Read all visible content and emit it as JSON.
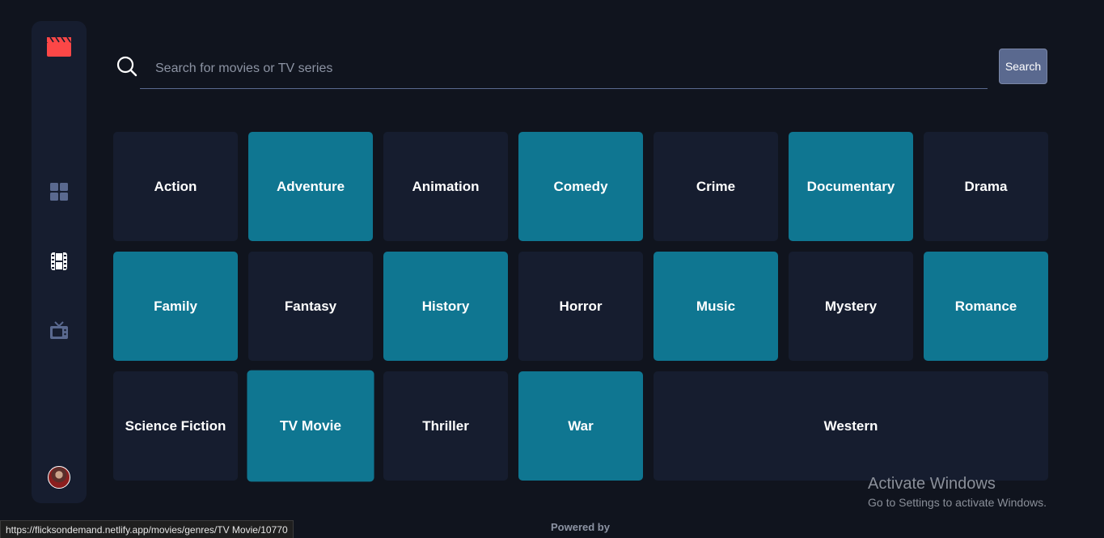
{
  "sidebar": {
    "logo_icon": "clapperboard-icon",
    "nav": [
      {
        "icon": "grid-icon",
        "label": "Home"
      },
      {
        "icon": "film-icon",
        "label": "Movies"
      },
      {
        "icon": "tv-icon",
        "label": "TV Series"
      }
    ]
  },
  "search": {
    "placeholder": "Search for movies or TV series",
    "value": "",
    "button_label": "Search"
  },
  "genres": [
    {
      "label": "Action",
      "style": "dark"
    },
    {
      "label": "Adventure",
      "style": "teal"
    },
    {
      "label": "Animation",
      "style": "dark"
    },
    {
      "label": "Comedy",
      "style": "teal"
    },
    {
      "label": "Crime",
      "style": "dark"
    },
    {
      "label": "Documentary",
      "style": "teal"
    },
    {
      "label": "Drama",
      "style": "dark"
    },
    {
      "label": "Family",
      "style": "teal"
    },
    {
      "label": "Fantasy",
      "style": "dark"
    },
    {
      "label": "History",
      "style": "teal"
    },
    {
      "label": "Horror",
      "style": "dark"
    },
    {
      "label": "Music",
      "style": "teal"
    },
    {
      "label": "Mystery",
      "style": "dark"
    },
    {
      "label": "Romance",
      "style": "teal"
    },
    {
      "label": "Science Fiction",
      "style": "dark"
    },
    {
      "label": "TV Movie",
      "style": "teal",
      "hovered": true
    },
    {
      "label": "Thriller",
      "style": "dark"
    },
    {
      "label": "War",
      "style": "teal"
    },
    {
      "label": "Western",
      "style": "dark"
    }
  ],
  "footer": {
    "powered_by": "Powered by"
  },
  "status_bar": {
    "url": "https://flicksondemand.netlify.app/movies/genres/TV Movie/10770"
  },
  "watermark": {
    "title": "Activate Windows",
    "subtitle": "Go to Settings to activate Windows."
  },
  "colors": {
    "background": "#10141e",
    "surface": "#161d2f",
    "accent_teal": "#0f7691",
    "accent_red": "#fc4747",
    "muted": "#5a698f"
  }
}
